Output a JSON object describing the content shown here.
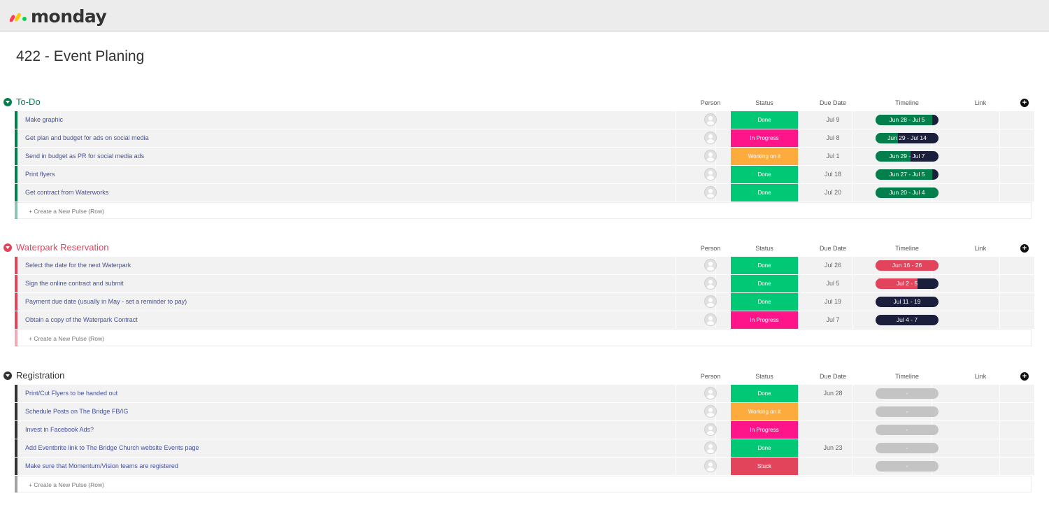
{
  "app": {
    "brand": "monday"
  },
  "board": {
    "title": "422 - Event Planing"
  },
  "columns": {
    "person": "Person",
    "status": "Status",
    "due": "Due Date",
    "timeline": "Timeline",
    "link": "Link"
  },
  "colors": {
    "done": "#00c875",
    "in_progress": "#ff158a",
    "working": "#fdab3d",
    "stuck": "#e2445c",
    "todo_group": "#037f4c",
    "waterpark_group": "#e2445c",
    "registration_group": "#333333",
    "timeline_dark": "#1c1f3b",
    "timeline_empty": "#c4c4c4"
  },
  "groups": [
    {
      "title": "To-Do",
      "color": "#037f4c",
      "create_label": "+ Create a New Pulse (Row)",
      "rows": [
        {
          "name": "Make graphic",
          "status": "Done",
          "status_color": "#00c875",
          "due": "Jul 9",
          "timeline": "Jun 28 - Jul 5",
          "timeline_progress": 0.9
        },
        {
          "name": "Get plan and budget for ads on social media",
          "status": "In Progress",
          "status_color": "#ff158a",
          "due": "Jul 8",
          "timeline": "Jun 29 - Jul 14",
          "timeline_progress": 0.35
        },
        {
          "name": "Send in budget as PR for social media ads",
          "status": "Working on it",
          "status_color": "#fdab3d",
          "due": "Jul 1",
          "timeline": "Jun 29 - Jul 7",
          "timeline_progress": 0.55
        },
        {
          "name": "Print flyers",
          "status": "Done",
          "status_color": "#00c875",
          "due": "Jul 18",
          "timeline": "Jun 27 - Jul 5",
          "timeline_progress": 0.9
        },
        {
          "name": "Get contract from Waterworks",
          "status": "Done",
          "status_color": "#00c875",
          "due": "Jul 20",
          "timeline": "Jun 20 - Jul 4",
          "timeline_progress": 1.0
        }
      ]
    },
    {
      "title": "Waterpark Reservation",
      "color": "#e2445c",
      "create_label": "+ Create a New Pulse (Row)",
      "rows": [
        {
          "name": "Select the date for the next Waterpark",
          "status": "Done",
          "status_color": "#00c875",
          "due": "Jul 26",
          "timeline": "Jun 16 - 26",
          "timeline_progress": 1.0
        },
        {
          "name": "Sign the online contract and submit",
          "status": "Done",
          "status_color": "#00c875",
          "due": "Jul 5",
          "timeline": "Jul 2 - 5",
          "timeline_progress": 0.67
        },
        {
          "name": "Payment due date (usually in May - set a reminder to pay)",
          "status": "Done",
          "status_color": "#00c875",
          "due": "Jul 19",
          "timeline": "Jul 11 - 19",
          "timeline_progress": 0.0
        },
        {
          "name": "Obtain a copy of the Waterpark Contract",
          "status": "In Progress",
          "status_color": "#ff158a",
          "due": "Jul 7",
          "timeline": "Jul 4 - 7",
          "timeline_progress": 0.0
        }
      ]
    },
    {
      "title": "Registration",
      "color": "#333333",
      "create_label": "+ Create a New Pulse (Row)",
      "rows": [
        {
          "name": "Print/Cut Flyers to be handed out",
          "status": "Done",
          "status_color": "#00c875",
          "due": "Jun 28",
          "timeline": "-",
          "timeline_progress": null
        },
        {
          "name": "Schedule Posts on The Bridge FB/IG",
          "status": "Working on it",
          "status_color": "#fdab3d",
          "due": "",
          "timeline": "-",
          "timeline_progress": null
        },
        {
          "name": "Invest in Facebook Ads?",
          "status": "In Progress",
          "status_color": "#ff158a",
          "due": "",
          "timeline": "-",
          "timeline_progress": null
        },
        {
          "name": "Add Eventbrite link to The Bridge Church website Events page",
          "status": "Done",
          "status_color": "#00c875",
          "due": "Jun 23",
          "timeline": "-",
          "timeline_progress": null
        },
        {
          "name": "Make sure that Momentum/Vision teams are registered",
          "status": "Stuck",
          "status_color": "#e2445c",
          "due": "",
          "timeline": "-",
          "timeline_progress": null
        }
      ]
    }
  ]
}
